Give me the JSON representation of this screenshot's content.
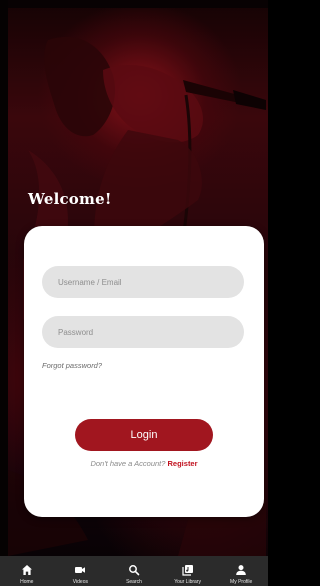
{
  "welcome": {
    "title": "Welcome!"
  },
  "login_form": {
    "username_placeholder": "Username / Email",
    "password_placeholder": "Password",
    "forgot_label": "Forgot password?",
    "login_label": "Login",
    "register_prompt": "Don't have a Account?",
    "register_label": "Register"
  },
  "bottom_nav": {
    "items": [
      {
        "label": "Home",
        "icon": "home-icon"
      },
      {
        "label": "Videos",
        "icon": "video-camera-icon"
      },
      {
        "label": "Search",
        "icon": "search-icon"
      },
      {
        "label": "Your Library",
        "icon": "library-icon"
      },
      {
        "label": "My Profile",
        "icon": "profile-icon"
      }
    ]
  },
  "colors": {
    "accent": "#a1161f",
    "register_link": "#c1121f",
    "nav_background": "#2b2b2b",
    "card_background": "#ffffff",
    "field_background": "#e3e3e3"
  }
}
